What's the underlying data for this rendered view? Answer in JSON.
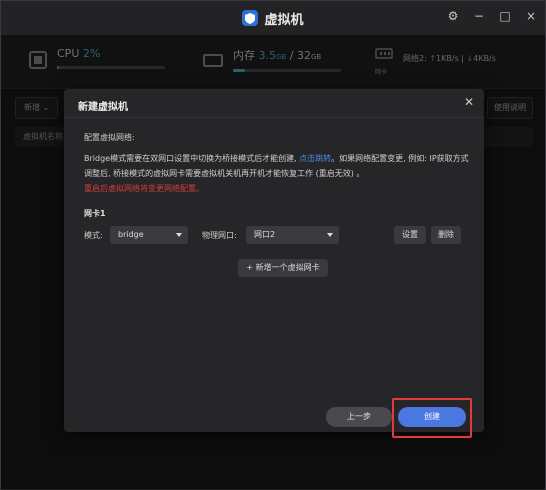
{
  "app": {
    "title": "虚拟机",
    "logo_icon": "shield-logo-icon"
  },
  "window_controls": {
    "settings": "⚙",
    "minimize": "−",
    "maximize": "□",
    "close": "×"
  },
  "stats": {
    "cpu": {
      "label": "CPU",
      "value": "2%",
      "fraction": 0.02
    },
    "ram": {
      "label": "内存",
      "used": "3.5",
      "used_unit": "GB",
      "sep": "/",
      "total": "32",
      "total_unit": "GB",
      "fraction": 0.11
    },
    "network": {
      "label": "网络2:",
      "up_arrow": "↑",
      "up": "1KB/s",
      "pipe": "|",
      "down_arrow": "↓",
      "down": "4KB/s",
      "caption": "网卡"
    }
  },
  "background": {
    "new_button": "新增",
    "help_button": "使用说明",
    "table_header_name": "虚拟机名称"
  },
  "modal": {
    "title": "新建虚拟机",
    "section_heading": "配置虚拟网络:",
    "desc_part1": "Bridge模式需要在双网口设置中切换为桥接模式后才能创建,",
    "desc_link": "点击跳转",
    "desc_part2": "。如果网络配置变更, 例如: IP获取方式调整后, 桥接模式的虚拟网卡需要虚拟机关机再开机才能恢复工作 (重启无效) 。",
    "desc_warning": "重启后虚拟网络将变更网络配置。",
    "nic_heading": "网卡1",
    "mode_label": "模式:",
    "mode_value": "bridge",
    "port_label": "物理网口:",
    "port_value": "网口2",
    "settings_button": "设置",
    "delete_button": "删除",
    "add_nic_button": "+ 新增一个虚拟网卡",
    "prev_button": "上一步",
    "create_button": "创建"
  },
  "colors": {
    "accent": "#4a78e0",
    "highlight": "#e23b3b",
    "link": "#4a8be0",
    "stat": "#4db1c9"
  }
}
